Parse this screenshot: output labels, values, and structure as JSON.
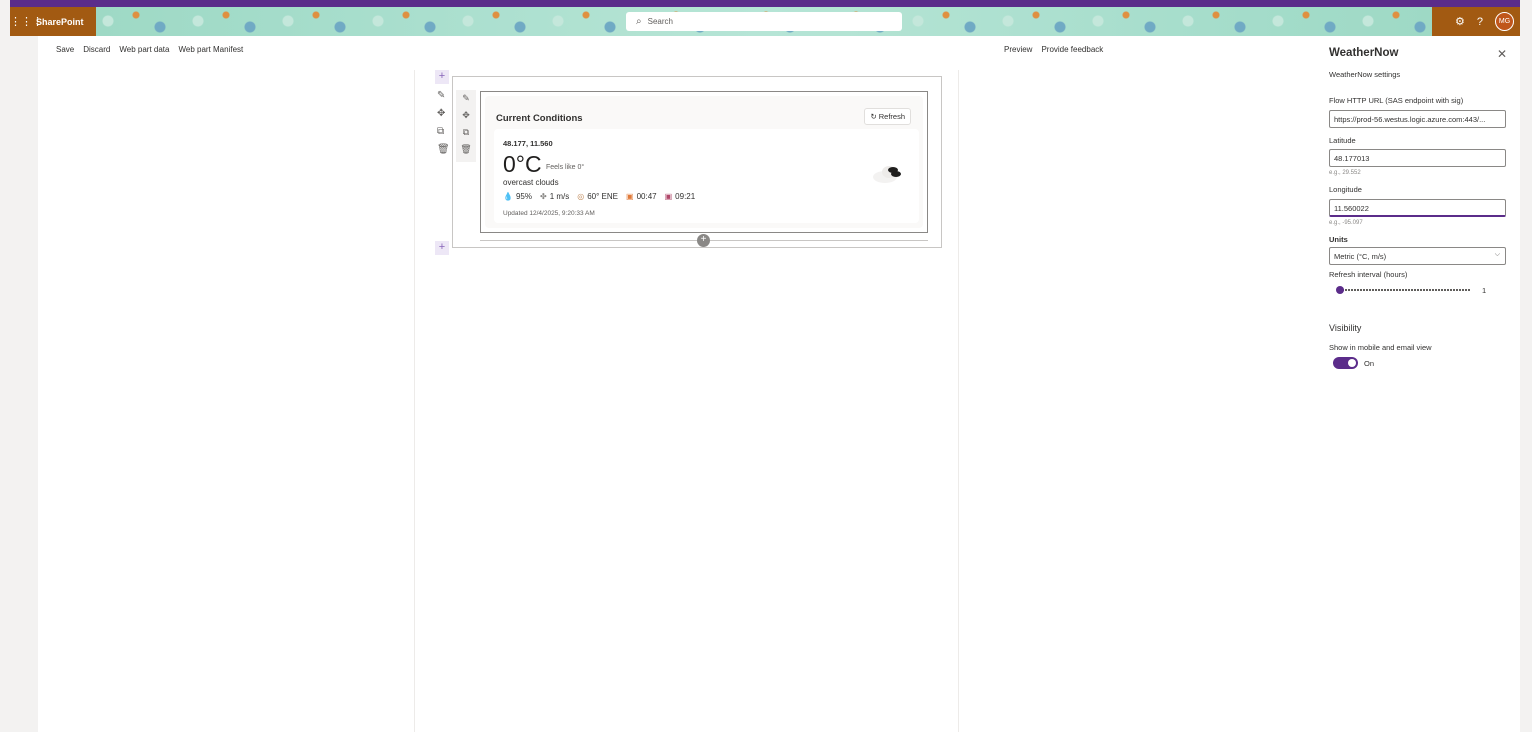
{
  "suite": {
    "app_name": "SharePoint",
    "search_placeholder": "Search",
    "avatar_initials": "MG"
  },
  "command_bar": {
    "left": [
      "Save",
      "Discard",
      "Web part data",
      "Web part Manifest"
    ],
    "right": [
      "Preview",
      "Provide feedback"
    ]
  },
  "webpart": {
    "title": "Current Conditions",
    "refresh_label": "Refresh",
    "coords": "48.177, 11.560",
    "temperature": "0°C",
    "feels_like": "Feels like 0°",
    "description": "overcast clouds",
    "humidity": "95%",
    "wind": "1 m/s",
    "wind_dir": "60° ENE",
    "sunrise": "00:47",
    "sunset": "09:21",
    "updated": "Updated 12/4/2025, 9:20:33 AM"
  },
  "panel": {
    "title": "WeatherNow",
    "subtitle": "WeatherNow settings",
    "flow_label": "Flow HTTP URL (SAS endpoint with sig)",
    "flow_value": "https://prod-56.westus.logic.azure.com:443/...",
    "lat_label": "Latitude",
    "lat_value": "48.177013",
    "lat_hint": "e.g., 29.552",
    "lon_label": "Longitude",
    "lon_value": "11.560022",
    "lon_hint": "e.g., -95.097",
    "units_label": "Units",
    "units_value": "Metric (°C, m/s)",
    "refresh_label": "Refresh interval (hours)",
    "refresh_value": "1",
    "visibility_heading": "Visibility",
    "visibility_label": "Show in mobile and email view",
    "toggle_state": "On"
  },
  "colors": {
    "accent": "#5b2c8a",
    "brand": "#a25a12",
    "banner": "#8fd4bf"
  }
}
